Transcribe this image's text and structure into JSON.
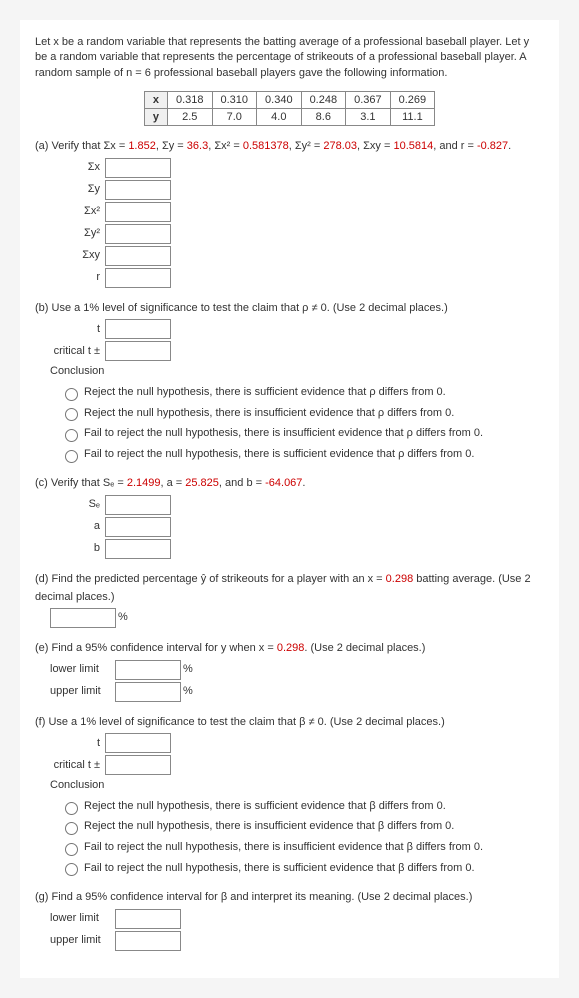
{
  "intro": "Let x be a random variable that represents the batting average of a professional baseball player. Let y be a random variable that represents the percentage of strikeouts of a professional baseball player. A random sample of n = 6 professional baseball players gave the following information.",
  "table": {
    "rowX_label": "x",
    "rowY_label": "y",
    "x": [
      "0.318",
      "0.310",
      "0.340",
      "0.248",
      "0.367",
      "0.269"
    ],
    "y": [
      "2.5",
      "7.0",
      "4.0",
      "8.6",
      "3.1",
      "11.1"
    ]
  },
  "a": {
    "text_pre": "(a) Verify that Σx = ",
    "v1": "1.852",
    "t2": ", Σy = ",
    "v2": "36.3",
    "t3": ", Σx² = ",
    "v3": "0.581378",
    "t4": ", Σy² = ",
    "v4": "278.03",
    "t5": ", Σxy = ",
    "v5": "10.5814",
    "t6": ", and r = ",
    "v6": "-0.827",
    "t7": ".",
    "labels": [
      "Σx",
      "Σy",
      "Σx²",
      "Σy²",
      "Σxy",
      "r"
    ]
  },
  "b": {
    "text": "(b) Use a 1% level of significance to test the claim that ρ ≠ 0. (Use 2 decimal places.)",
    "l_t": "t",
    "l_crit": "critical t ±",
    "concl": "Conclusion",
    "opts": [
      "Reject the null hypothesis, there is sufficient evidence that ρ differs from 0.",
      "Reject the null hypothesis, there is insufficient evidence that ρ differs from 0.",
      "Fail to reject the null hypothesis, there is insufficient evidence that ρ differs from 0.",
      "Fail to reject the null hypothesis, there is sufficient evidence that ρ differs from 0."
    ]
  },
  "c": {
    "pre": "(c) Verify that Sₑ = ",
    "v1": "2.1499",
    "t2": ", a = ",
    "v2": "25.825",
    "t3": ", and b = ",
    "v3": "-64.067",
    "t4": ".",
    "labels": [
      "Sₑ",
      "a",
      "b"
    ]
  },
  "d": {
    "pre": "(d) Find the predicted percentage ŷ of strikeouts for a player with an x = ",
    "v": "0.298",
    "post": " batting average. (Use 2 decimal places.)",
    "pct": "%"
  },
  "e": {
    "pre": "(e) Find a 95% confidence interval for y when x = ",
    "v": "0.298",
    "post": ". (Use 2 decimal places.)",
    "ll": "lower limit",
    "ul": "upper limit",
    "pct": "%"
  },
  "f": {
    "text": "(f) Use a 1% level of significance to test the claim that β ≠ 0. (Use 2 decimal places.)",
    "l_t": "t",
    "l_crit": "critical t ±",
    "concl": "Conclusion",
    "opts": [
      "Reject the null hypothesis, there is sufficient evidence that β differs from 0.",
      "Reject the null hypothesis, there is insufficient evidence that β differs from 0.",
      "Fail to reject the null hypothesis, there is insufficient evidence that β differs from 0.",
      "Fail to reject the null hypothesis, there is sufficient evidence that β differs from 0."
    ]
  },
  "g": {
    "text": "(g) Find a 95% confidence interval for β and interpret its meaning. (Use 2 decimal places.)",
    "ll": "lower limit",
    "ul": "upper limit"
  }
}
